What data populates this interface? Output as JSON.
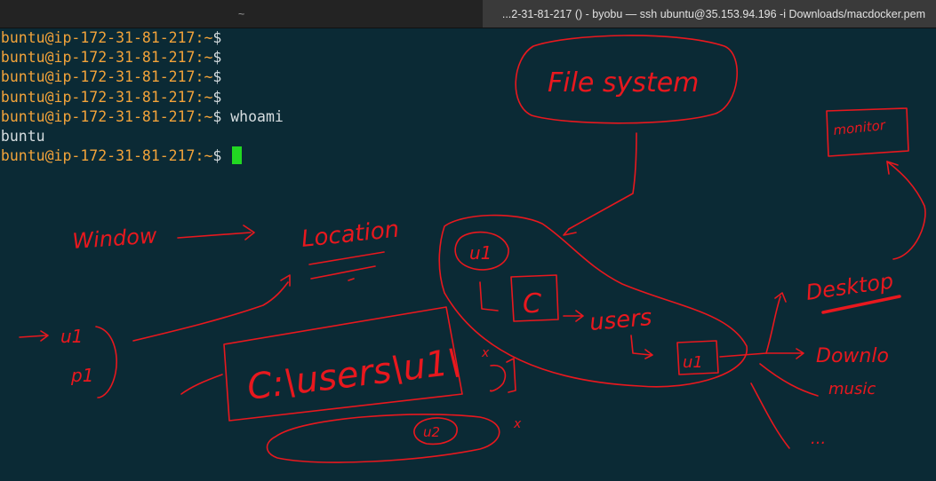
{
  "tabs": [
    {
      "label": "~",
      "active": false
    },
    {
      "label": "...2-31-81-217 () - byobu — ssh ubuntu@35.153.94.196 -i Downloads/macdocker.pem",
      "active": true
    }
  ],
  "terminal": {
    "prompt": {
      "user": "ubuntu",
      "at": "@",
      "host": "ip-172-31-81-217",
      "colon": ":",
      "path": "~",
      "dollar": "$"
    },
    "lines": [
      {
        "type": "prompt",
        "command": ""
      },
      {
        "type": "prompt",
        "command": ""
      },
      {
        "type": "prompt",
        "command": ""
      },
      {
        "type": "prompt",
        "command": ""
      },
      {
        "type": "prompt",
        "command": " whoami"
      },
      {
        "type": "output",
        "text": "ubuntu"
      },
      {
        "type": "prompt",
        "command": " ",
        "cursor": true
      }
    ],
    "cursor_color": "#22d822",
    "prompt_color": "#f2a33a",
    "background": "#0b2a35"
  },
  "annotations": {
    "color": "#e8181e",
    "labels": {
      "file_system": "File system",
      "monitor": "monitor",
      "window": "Window",
      "location": "Location",
      "u1_top": "u1",
      "c_box": "C",
      "users": "users",
      "u1_box": "u1",
      "desktop": "Desktop",
      "download": "Downlo",
      "music": "music",
      "u1_left": "u1",
      "p1_left": "p1",
      "path_box": "C:\\users\\u1\\",
      "u2": "u2",
      "x_mark_1": "x",
      "x_mark_2": "x",
      "ellipsis": "..."
    }
  }
}
